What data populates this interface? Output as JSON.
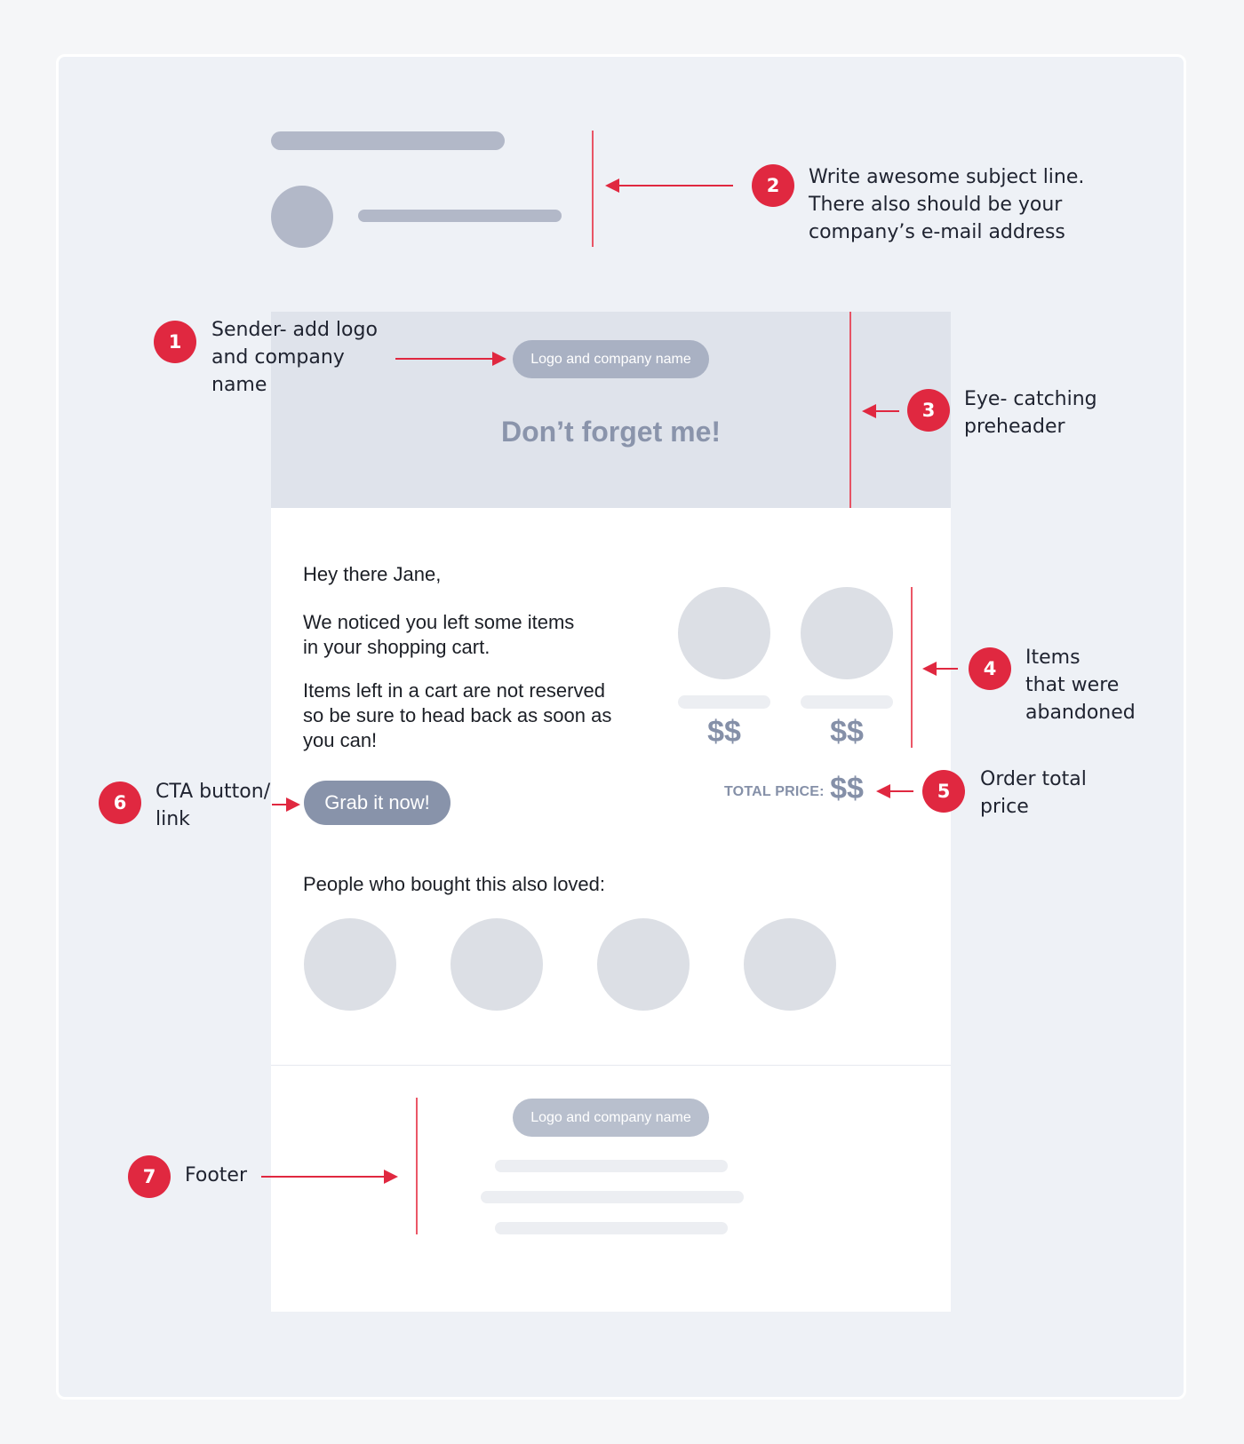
{
  "colors": {
    "accent": "#e02840",
    "page_bg": "#f5f6f8",
    "card_bg": "#eef1f6",
    "header_band": "#dfe3eb",
    "skeleton": "#b2b8c8",
    "muted_text": "#8590a8"
  },
  "annotations": [
    {
      "number": "1",
      "text": "Sender- add logo\nand company\nname"
    },
    {
      "number": "2",
      "text": "Write awesome subject line.\nThere also should be your\ncompany’s e-mail address"
    },
    {
      "number": "3",
      "text": "Eye- catching\npreheader"
    },
    {
      "number": "4",
      "text": "Items\nthat were\nabandoned"
    },
    {
      "number": "5",
      "text": "Order total\nprice"
    },
    {
      "number": "6",
      "text": "CTA button/\nlink"
    },
    {
      "number": "7",
      "text": "Footer"
    }
  ],
  "email": {
    "header": {
      "logo_label": "Logo and company name",
      "headline": "Don’t forget me!"
    },
    "body": {
      "greeting": "Hey there Jane,",
      "paragraph1": "We noticed you left some items\nin your shopping cart.",
      "paragraph2": "Items left in a cart are not reserved\nso be sure to head back as soon as\nyou can!",
      "cart_items": [
        {
          "price": "$$"
        },
        {
          "price": "$$"
        }
      ],
      "total_label": "TOTAL PRICE:",
      "total_value": "$$",
      "cta_label": "Grab it now!",
      "recommend_heading": "People who bought this also loved:",
      "recommend_count": 4
    },
    "footer": {
      "logo_label": "Logo and company name"
    }
  }
}
